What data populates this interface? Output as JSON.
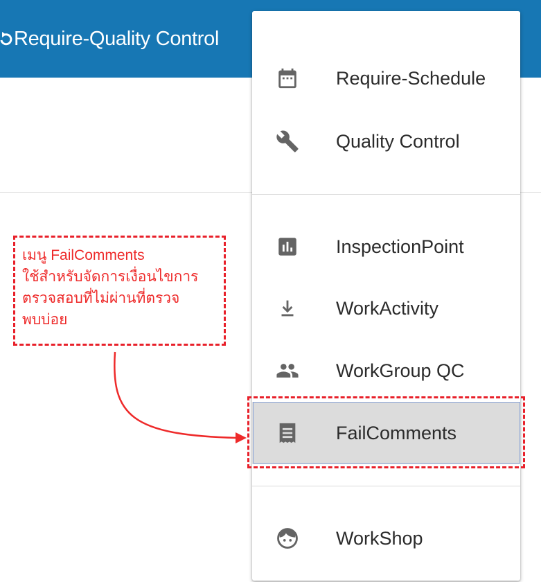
{
  "header": {
    "title": "Require-Quality Control",
    "background_color": "#1777b4"
  },
  "menu": {
    "items": [
      {
        "label": "Require-Schedule",
        "icon": "calendar-icon"
      },
      {
        "label": "Quality Control",
        "icon": "wrench-icon"
      },
      {
        "label": "InspectionPoint",
        "icon": "bar-chart-icon"
      },
      {
        "label": "WorkActivity",
        "icon": "download-arrow-icon"
      },
      {
        "label": "WorkGroup QC",
        "icon": "people-icon"
      },
      {
        "label": "FailComments",
        "icon": "receipt-icon",
        "selected": true
      },
      {
        "label": "WorkShop",
        "icon": "face-icon"
      }
    ]
  },
  "annotation": {
    "text": "เมนู FailComments\nใช้สำหรับจัดการเงื่อนไขการ\nตรวจสอบที่ไม่ผ่านที่ตรวจ\nพบบ่อย",
    "color": "#ee2a2a"
  }
}
